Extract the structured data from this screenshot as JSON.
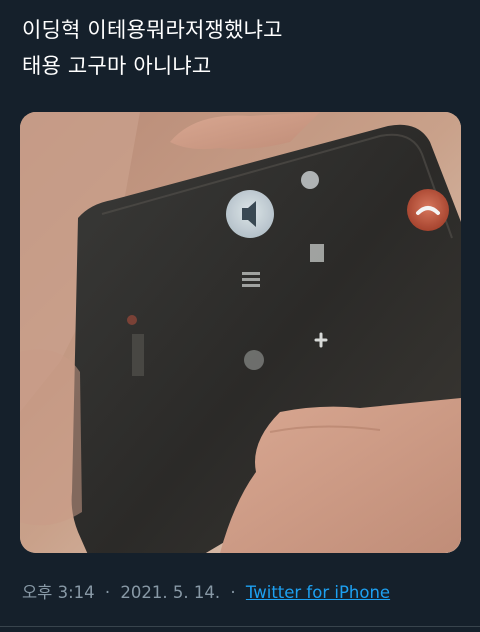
{
  "tweet": {
    "lines": [
      "이딩혁 이테용뭐라저쟁했냐고",
      "태용 고구마 아니냐고"
    ]
  },
  "meta": {
    "time": "오후 3:14",
    "separator": "·",
    "date": "2021. 5. 14.",
    "source": "Twitter for iPhone"
  },
  "colors": {
    "background": "#15202b",
    "text": "#ffffff",
    "muted": "#8899a6",
    "link": "#1da1f2",
    "end_call": "#c0533a"
  },
  "icons": {
    "speaker": "speaker-icon",
    "end_call": "end-call-icon",
    "keypad": "keypad-icon",
    "add_call": "plus-icon"
  }
}
